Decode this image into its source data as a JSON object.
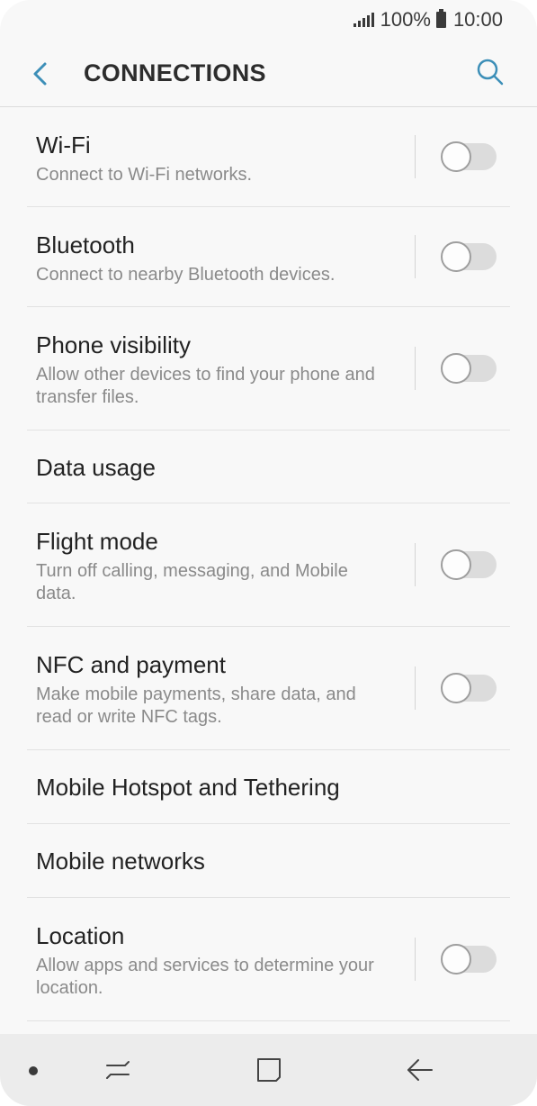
{
  "status_bar": {
    "battery": "100%",
    "time": "10:00"
  },
  "header": {
    "title": "CONNECTIONS"
  },
  "items": [
    {
      "label": "Wi-Fi",
      "sub": "Connect to Wi-Fi networks.",
      "toggle": false
    },
    {
      "label": "Bluetooth",
      "sub": "Connect to nearby Bluetooth devices.",
      "toggle": false
    },
    {
      "label": "Phone visibility",
      "sub": "Allow other devices to find your phone and transfer files.",
      "toggle": false
    },
    {
      "label": "Data usage"
    },
    {
      "label": "Flight mode",
      "sub": "Turn off calling, messaging, and Mobile data.",
      "toggle": false
    },
    {
      "label": "NFC and payment",
      "sub": "Make mobile payments, share data, and read or write NFC tags.",
      "toggle": false
    },
    {
      "label": "Mobile Hotspot and Tethering"
    },
    {
      "label": "Mobile networks"
    },
    {
      "label": "Location",
      "sub": "Allow apps and services to determine your location.",
      "toggle": false
    }
  ],
  "colors": {
    "accent": "#3d8fb8",
    "background": "#f8f8f8",
    "navbar": "#ececec"
  }
}
